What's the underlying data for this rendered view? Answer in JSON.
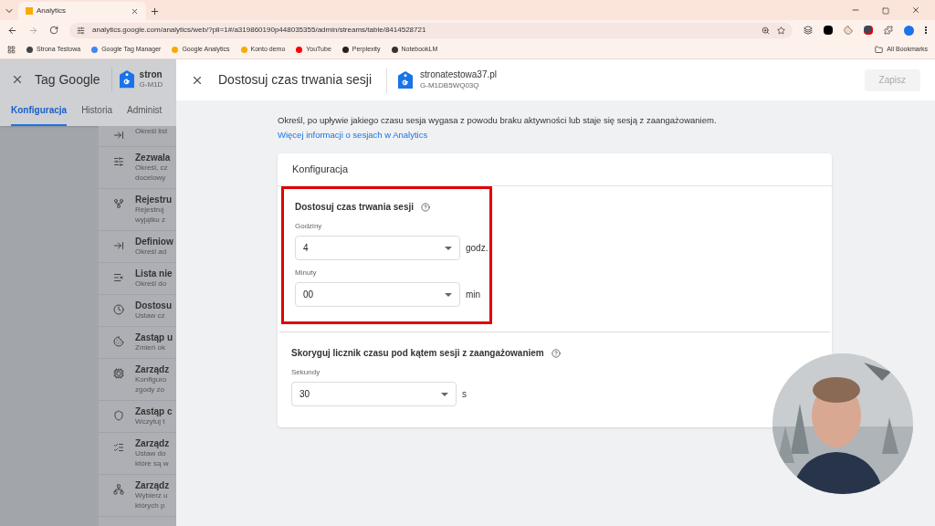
{
  "browser": {
    "tab": {
      "title": "Analytics"
    },
    "url": "analytics.google.com/analytics/web/?pli=1#/a319860190p448035355/admin/streams/table/8414528721",
    "bookmarks": [
      {
        "label": "Strona Testowa"
      },
      {
        "label": "Google Tag Manager"
      },
      {
        "label": "Google Analytics"
      },
      {
        "label": "Konto demo"
      },
      {
        "label": "YouTube"
      },
      {
        "label": "Perplexity"
      },
      {
        "label": "NotebookLM"
      }
    ],
    "all_bookmarks": "All Bookmarks"
  },
  "background_panel": {
    "title": "Tag Google",
    "tag_name": "stron",
    "tag_id": "G-M1D",
    "tabs": [
      {
        "label": "Konfiguracja",
        "selected": true
      },
      {
        "label": "Historia",
        "selected": false
      },
      {
        "label": "Administ",
        "selected": false
      }
    ],
    "items": [
      {
        "lines": [
          "Określ list"
        ]
      },
      {
        "title": "Zezwala",
        "lines": [
          "Określ, cz",
          "docelowy"
        ]
      },
      {
        "title": "Rejestru",
        "lines": [
          "Rejestruj",
          "wyjątku z"
        ]
      },
      {
        "title": "Definiow",
        "lines": [
          "Określ ad"
        ]
      },
      {
        "title": "Lista nie",
        "lines": [
          "Określ do"
        ]
      },
      {
        "title": "Dostosu",
        "lines": [
          "Ustaw cz"
        ]
      },
      {
        "title": "Zastąp u",
        "lines": [
          "Zmień ok"
        ]
      },
      {
        "title": "Zarządz",
        "lines": [
          "Konfiguro",
          "zgody zo"
        ]
      },
      {
        "title": "Zastąp c",
        "lines": [
          "Wczytuj t"
        ]
      },
      {
        "title": "Zarządz",
        "lines": [
          "Ustaw do",
          "które są w"
        ]
      },
      {
        "title": "Zarządz",
        "lines": [
          "Wybierz u",
          "których p"
        ]
      }
    ]
  },
  "dialog": {
    "title": "Dostosuj czas trwania sesji",
    "tag_name": "stronatestowa37.pl",
    "tag_id": "G-M1DB5WQ03Q",
    "save_button": {
      "label": "Zapisz",
      "disabled": true
    },
    "intro": "Określ, po upływie jakiego czasu sesja wygasa z powodu braku aktywności lub staje się sesją z zaangażowaniem.",
    "intro_link": "Więcej informacji o sesjach w Analytics",
    "card_title": "Konfiguracja",
    "sections": [
      {
        "heading": "Dostosuj czas trwania sesji",
        "highlighted": true,
        "fields": [
          {
            "label": "Godziny",
            "value": "4",
            "unit": "godz."
          },
          {
            "label": "Minuty",
            "value": "00",
            "unit": "min"
          }
        ]
      },
      {
        "heading": "Skoryguj licznik czasu pod kątem sesji z zaangażowaniem",
        "highlighted": false,
        "fields": [
          {
            "label": "Sekundy",
            "value": "30",
            "unit": "s"
          }
        ]
      }
    ]
  }
}
